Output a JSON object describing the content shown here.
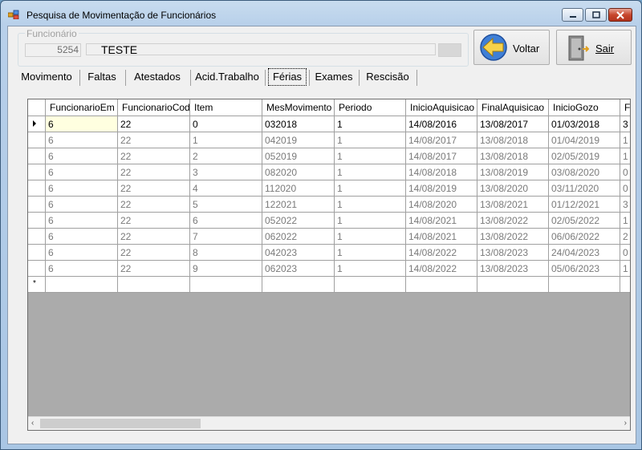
{
  "window": {
    "title": "Pesquisa de Movimentação de Funcionários"
  },
  "funcionario": {
    "group_label": "Funcionário",
    "id": "5254",
    "name": "TESTE"
  },
  "buttons": {
    "voltar": "Voltar",
    "sair": "Sair"
  },
  "tabs": [
    "Movimento",
    "Faltas",
    "Atestados",
    "Acid.Trabalho",
    "Férias",
    "Exames",
    "Rescisão"
  ],
  "active_tab": "Férias",
  "grid": {
    "columns": [
      "FuncionarioEm",
      "FuncionarioCod",
      "Item",
      "MesMovimento",
      "Periodo",
      "InicioAquisicao",
      "FinalAquisicao",
      "InicioGozo",
      "F"
    ],
    "rows": [
      [
        "6",
        "22",
        "0",
        "032018",
        "1",
        "14/08/2016",
        "13/08/2017",
        "01/03/2018",
        "3"
      ],
      [
        "6",
        "22",
        "1",
        "042019",
        "1",
        "14/08/2017",
        "13/08/2018",
        "01/04/2019",
        "1"
      ],
      [
        "6",
        "22",
        "2",
        "052019",
        "1",
        "14/08/2017",
        "13/08/2018",
        "02/05/2019",
        "1"
      ],
      [
        "6",
        "22",
        "3",
        "082020",
        "1",
        "14/08/2018",
        "13/08/2019",
        "03/08/2020",
        "0"
      ],
      [
        "6",
        "22",
        "4",
        "112020",
        "1",
        "14/08/2019",
        "13/08/2020",
        "03/11/2020",
        "0"
      ],
      [
        "6",
        "22",
        "5",
        "122021",
        "1",
        "14/08/2020",
        "13/08/2021",
        "01/12/2021",
        "3"
      ],
      [
        "6",
        "22",
        "6",
        "052022",
        "1",
        "14/08/2021",
        "13/08/2022",
        "02/05/2022",
        "1"
      ],
      [
        "6",
        "22",
        "7",
        "062022",
        "1",
        "14/08/2021",
        "13/08/2022",
        "06/06/2022",
        "2"
      ],
      [
        "6",
        "22",
        "8",
        "042023",
        "1",
        "14/08/2022",
        "13/08/2023",
        "24/04/2023",
        "0"
      ],
      [
        "6",
        "22",
        "9",
        "062023",
        "1",
        "14/08/2022",
        "13/08/2023",
        "05/06/2023",
        "1"
      ]
    ],
    "new_row_marker": "*"
  }
}
